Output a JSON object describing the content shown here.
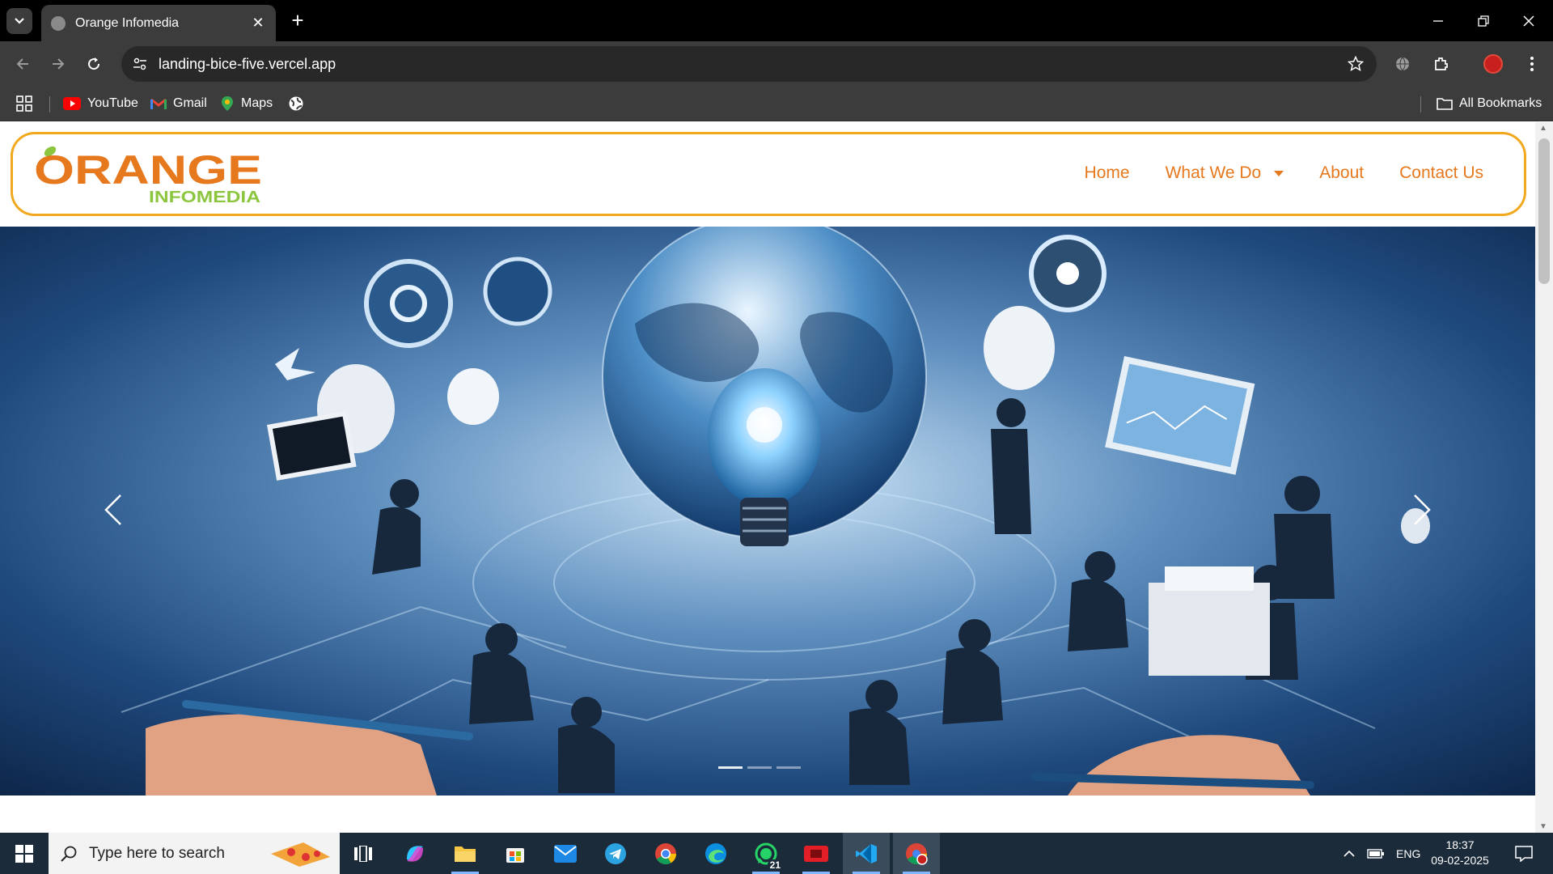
{
  "browser": {
    "tab_title": "Orange Infomedia",
    "url": "landing-bice-five.vercel.app",
    "bookmarks": [
      {
        "label": "YouTube",
        "icon": "youtube-icon"
      },
      {
        "label": "Gmail",
        "icon": "gmail-icon"
      },
      {
        "label": "Maps",
        "icon": "maps-icon"
      }
    ],
    "all_bookmarks_label": "All Bookmarks"
  },
  "site": {
    "logo": {
      "word": "ORANGE",
      "sub": "INFOMEDIA"
    },
    "nav": {
      "home": "Home",
      "what_we_do": "What We Do",
      "about": "About",
      "contact": "Contact Us"
    }
  },
  "taskbar": {
    "search_placeholder": "Type here to search",
    "whatsapp_badge": "21",
    "language": "ENG",
    "time": "18:37",
    "date": "09-02-2025"
  },
  "colors": {
    "brand_orange": "#e6781e",
    "brand_green": "#8cc63f",
    "nav_border": "#f2a81d"
  }
}
